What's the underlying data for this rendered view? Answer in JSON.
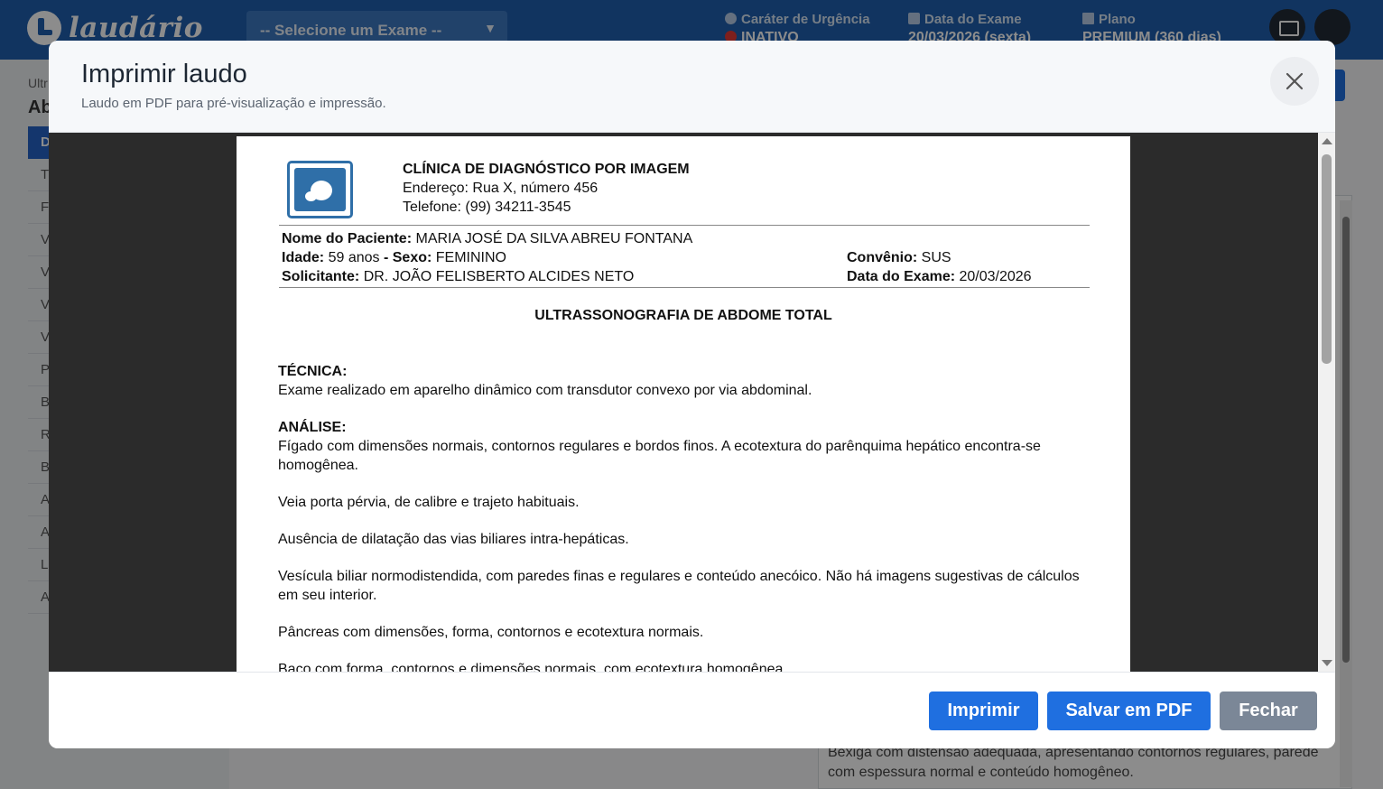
{
  "app": {
    "logo_text": "laudário",
    "exam_select": "-- Selecione um Exame --",
    "urgency": {
      "label": "Caráter de Urgência",
      "value": "INATIVO"
    },
    "exam_date": {
      "label": "Data do Exame",
      "value": "20/03/2026 (sexta)"
    },
    "plan": {
      "label": "Plano",
      "value": "PREMIUM (360 dias)"
    }
  },
  "background": {
    "crumb": "Ultr",
    "heading": "Ab",
    "active_menu": "D",
    "menu_items": [
      "T",
      "F",
      "V",
      "V",
      "V",
      "V",
      "P",
      "B",
      "R",
      "B",
      "A",
      "A",
      "L",
      "A"
    ],
    "right_text": "Bexiga com distensão adequada, apresentando contornos regulares, parede com espessura normal e conteúdo homogêneo."
  },
  "modal": {
    "title": "Imprimir laudo",
    "subtitle": "Laudo em PDF para pré-visualização e impressão.",
    "buttons": {
      "print": "Imprimir",
      "save_pdf": "Salvar em PDF",
      "close": "Fechar"
    }
  },
  "report": {
    "clinic": {
      "name": "CLÍNICA DE DIAGNÓSTICO POR IMAGEM",
      "address": "Endereço: Rua X, número 456",
      "phone": "Telefone: (99) 34211-3545"
    },
    "patient": {
      "name_label": "Nome do Paciente:",
      "name": "MARIA JOSÉ DA SILVA ABREU FONTANA",
      "age_label": "Idade:",
      "age": "59 anos",
      "sex_label": "- Sexo:",
      "sex": "FEMININO",
      "requester_label": "Solicitante:",
      "requester": "DR. JOÃO FELISBERTO ALCIDES NETO",
      "insurance_label": "Convênio:",
      "insurance": "SUS",
      "date_label": "Data do Exame:",
      "date": "20/03/2026"
    },
    "exam_title": "ULTRASSONOGRAFIA DE ABDOME TOTAL",
    "technique_label": "TÉCNICA:",
    "technique": "Exame realizado em aparelho dinâmico com transdutor convexo por via abdominal.",
    "analysis_label": "ANÁLISE:",
    "analysis": [
      "Fígado com dimensões normais, contornos regulares e bordos finos. A ecotextura do parênquima hepático encontra-se homogênea.",
      "Veia porta pérvia, de calibre e trajeto habituais.",
      "Ausência de dilatação das vias biliares intra-hepáticas.",
      "Vesícula biliar normodistendida, com paredes finas e regulares e conteúdo anecóico. Não há imagens sugestivas de cálculos em seu interior.",
      "Pâncreas com dimensões, forma, contornos e ecotextura normais.",
      "Baço com forma, contornos e dimensões normais, com ecotextura homogênea."
    ]
  }
}
